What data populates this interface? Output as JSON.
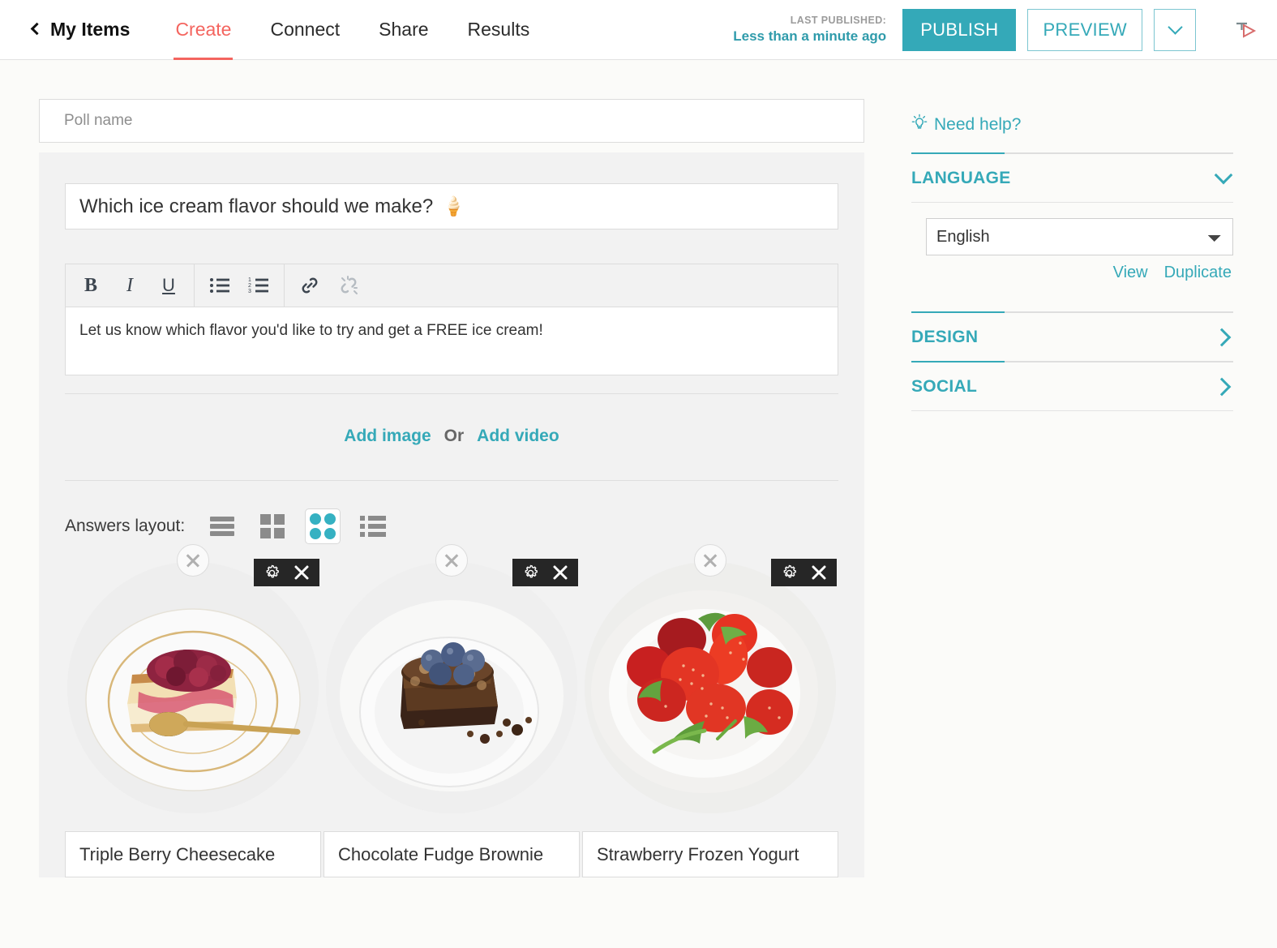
{
  "topbar": {
    "back_label": "My Items",
    "back_icon": "chevron-left-icon",
    "nav": [
      {
        "label": "Create",
        "active": true
      },
      {
        "label": "Connect",
        "active": false
      },
      {
        "label": "Share",
        "active": false
      },
      {
        "label": "Results",
        "active": false
      }
    ],
    "published_label": "LAST PUBLISHED:",
    "published_value": "Less than a minute ago",
    "publish_label": "PUBLISH",
    "preview_label": "PREVIEW",
    "caret_icon": "chevron-down-icon",
    "cursor_icon": "cursor-pointer-icon"
  },
  "poll": {
    "name_placeholder": "Poll name",
    "name_value": "",
    "question": "Which ice cream flavor should we make?",
    "question_emoji": "🍦",
    "description": "Let us know which flavor you'd like to try and get a FREE ice cream!"
  },
  "editor_toolbar": {
    "bold": "B",
    "italic": "I",
    "underline": "U",
    "bullet_list_icon": "bullet-list-icon",
    "numbered_list_icon": "numbered-list-icon",
    "link_icon": "link-icon",
    "unlink_icon": "unlink-icon"
  },
  "media": {
    "add_image": "Add image",
    "or": "Or",
    "add_video": "Add video"
  },
  "answers_layout": {
    "label": "Answers layout:",
    "options": [
      {
        "name": "rows-layout",
        "selected": false
      },
      {
        "name": "grid-layout",
        "selected": false
      },
      {
        "name": "circles-layout",
        "selected": true
      },
      {
        "name": "list-layout",
        "selected": false
      }
    ]
  },
  "answers": [
    {
      "label": "Triple Berry Cheesecake",
      "image_alt": "cheesecake-slice-with-berry-compote",
      "settings_icon": "gear-icon",
      "delete_icon": "close-icon",
      "remove_icon": "remove-circle-icon"
    },
    {
      "label": "Chocolate Fudge Brownie",
      "image_alt": "chocolate-brownie-with-blueberries",
      "settings_icon": "gear-icon",
      "delete_icon": "close-icon",
      "remove_icon": "remove-circle-icon"
    },
    {
      "label": "Strawberry Frozen Yogurt",
      "image_alt": "bowl-of-strawberries",
      "settings_icon": "gear-icon",
      "delete_icon": "close-icon",
      "remove_icon": "remove-circle-icon"
    }
  ],
  "sidebar": {
    "help_label": "Need help?",
    "help_icon": "lightbulb-icon",
    "language": {
      "title": "LANGUAGE",
      "chevron": "chevron-down-icon",
      "selected": "English",
      "options": [
        "English"
      ],
      "view": "View",
      "duplicate": "Duplicate"
    },
    "design": {
      "title": "DESIGN",
      "chevron": "chevron-right-icon"
    },
    "social": {
      "title": "SOCIAL",
      "chevron": "chevron-right-icon"
    }
  },
  "colors": {
    "accent_teal": "#35a9b8",
    "accent_red": "#f4655f",
    "panel_gray": "#f2f2f2",
    "page_bg": "#fbfbf9"
  }
}
